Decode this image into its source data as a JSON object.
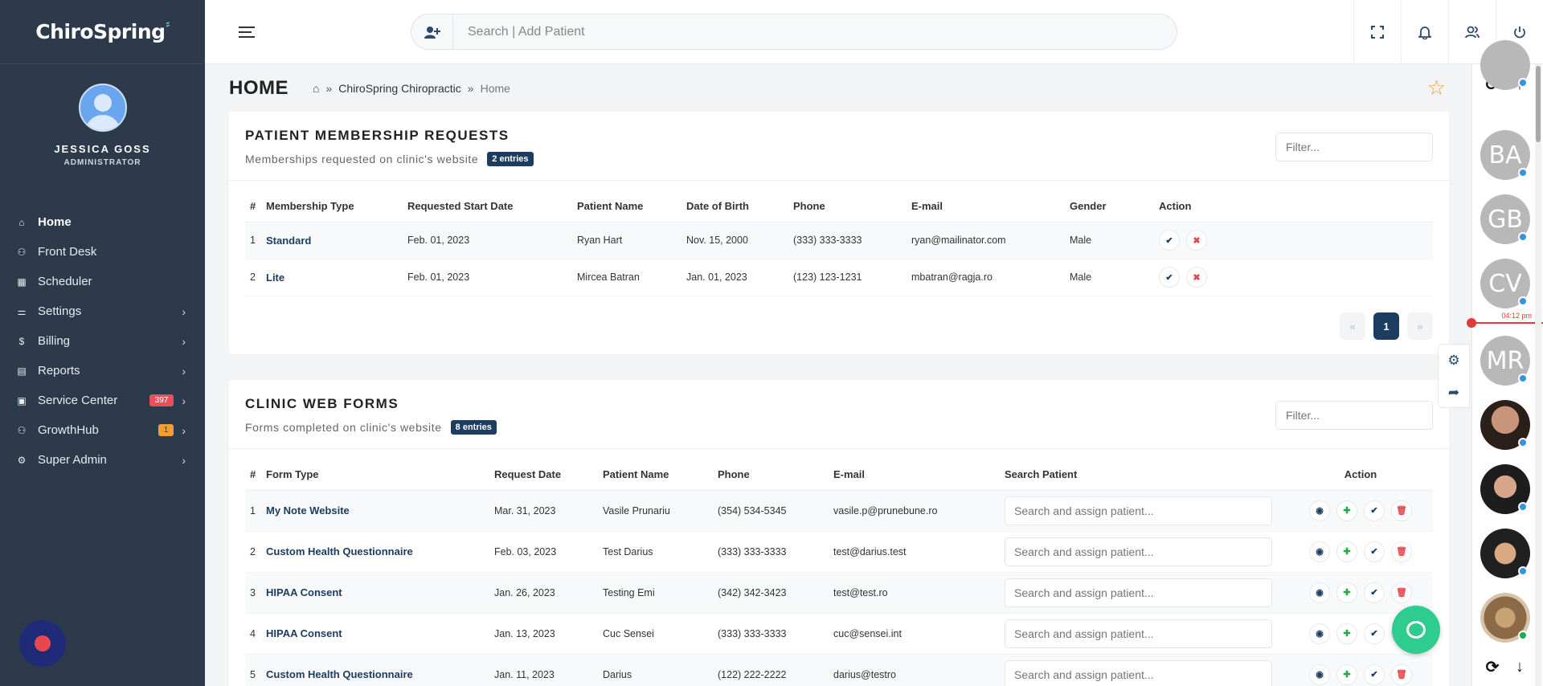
{
  "brand": {
    "name": "ChiroSpring",
    "mark": "⸗"
  },
  "profile": {
    "name": "JESSICA GOSS",
    "role": "ADMINISTRATOR"
  },
  "nav": [
    {
      "label": "Home",
      "icon": "⌂",
      "chevron": "",
      "badge": ""
    },
    {
      "label": "Front Desk",
      "icon": "⚇",
      "chevron": "",
      "badge": ""
    },
    {
      "label": "Scheduler",
      "icon": "▦",
      "chevron": "",
      "badge": ""
    },
    {
      "label": "Settings",
      "icon": "⚌",
      "chevron": "›",
      "badge": ""
    },
    {
      "label": "Billing",
      "icon": "$",
      "chevron": "›",
      "badge": ""
    },
    {
      "label": "Reports",
      "icon": "▤",
      "chevron": "›",
      "badge": ""
    },
    {
      "label": "Service Center",
      "icon": "▣",
      "chevron": "›",
      "badge": "397"
    },
    {
      "label": "GrowthHub",
      "icon": "⚇",
      "chevron": "›",
      "badge": "1"
    },
    {
      "label": "Super Admin",
      "icon": "⚙",
      "chevron": "›",
      "badge": ""
    }
  ],
  "search": {
    "placeholder": "Search | Add Patient"
  },
  "page": {
    "title": "HOME",
    "breadcrumb": [
      "ChiroSpring Chiropractic",
      "Home"
    ],
    "sep": "»"
  },
  "membership": {
    "title": "PATIENT MEMBERSHIP REQUESTS",
    "subtitle": "Memberships requested on clinic's website",
    "entries": "2 entries",
    "filter_placeholder": "Filter...",
    "columns": [
      "#",
      "Membership Type",
      "Requested Start Date",
      "Patient Name",
      "Date of Birth",
      "Phone",
      "E-mail",
      "Gender",
      "Action"
    ],
    "rows": [
      [
        "1",
        "Standard",
        "Feb. 01, 2023",
        "Ryan Hart",
        "Nov. 15, 2000",
        "(333) 333-3333",
        "ryan@mailinator.com",
        "Male"
      ],
      [
        "2",
        "Lite",
        "Feb. 01, 2023",
        "Mircea Batran",
        "Jan. 01, 2023",
        "(123) 123-1231",
        "mbatran@ragja.ro",
        "Male"
      ]
    ],
    "pager": {
      "prev": "«",
      "page": "1",
      "next": "»"
    }
  },
  "webforms": {
    "title": "CLINIC WEB FORMS",
    "subtitle": "Forms completed on clinic's website",
    "entries": "8 entries",
    "filter_placeholder": "Filter...",
    "assign_placeholder": "Search and assign patient...",
    "columns": [
      "#",
      "Form Type",
      "Request Date",
      "Patient Name",
      "Phone",
      "E-mail",
      "Search Patient",
      "Action"
    ],
    "rows": [
      [
        "1",
        "My Note Website",
        "Mar. 31, 2023",
        "Vasile Prunariu",
        "(354) 534-5345",
        "vasile.p@prunebune.ro"
      ],
      [
        "2",
        "Custom Health Questionnaire",
        "Feb. 03, 2023",
        "Test Darius",
        "(333) 333-3333",
        "test@darius.test"
      ],
      [
        "3",
        "HIPAA Consent",
        "Jan. 26, 2023",
        "Testing Emi",
        "(342) 342-3423",
        "test@test.ro"
      ],
      [
        "4",
        "HIPAA Consent",
        "Jan. 13, 2023",
        "Cuc Sensei",
        "(333) 333-3333",
        "cuc@sensei.int"
      ],
      [
        "5",
        "Custom Health Questionnaire",
        "Jan. 11, 2023",
        "Darius",
        "(122) 222-2222",
        "darius@testro"
      ]
    ]
  },
  "rail": {
    "avatars": [
      "BA",
      "GB",
      "CV",
      "MR"
    ],
    "time": "04:12 pm"
  },
  "icons": {
    "approve": "✔",
    "reject": "✖",
    "view": "◉",
    "assign": "✚",
    "delete": "🗑"
  },
  "colors": {
    "sidebar": "#2d3a4b",
    "accent": "#1d3d60",
    "danger": "#e5484d",
    "success": "#28a745",
    "star": "#f0a030",
    "chat": "#2ecc8f"
  }
}
